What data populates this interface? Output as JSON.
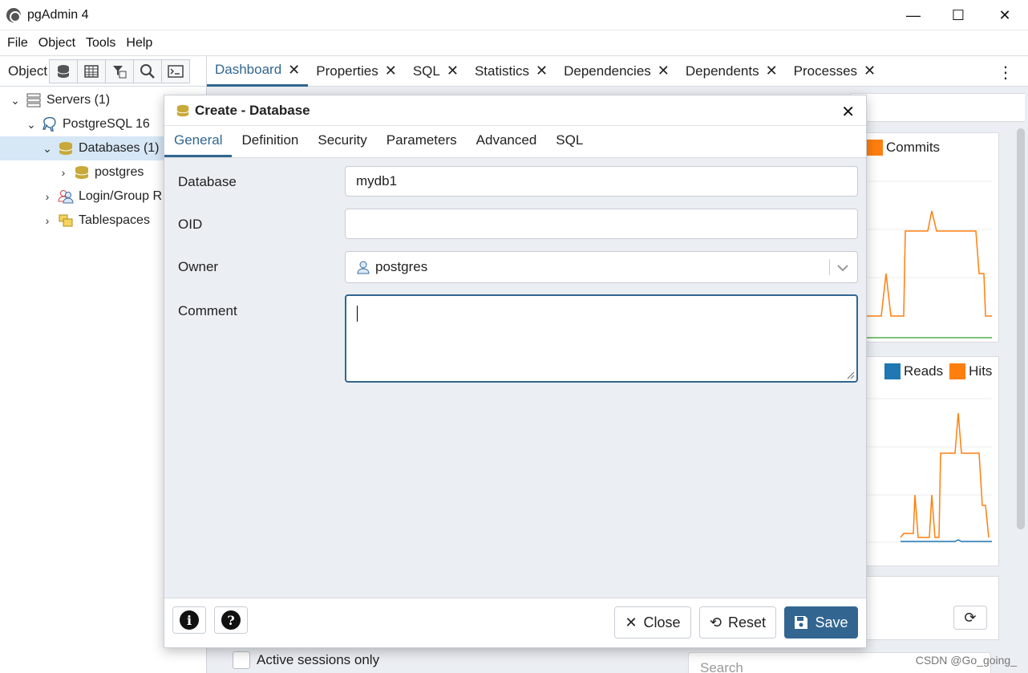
{
  "window": {
    "title": "pgAdmin 4",
    "minimize": "—",
    "maximize": "☐",
    "close": "✕"
  },
  "menu": [
    "File",
    "Object",
    "Tools",
    "Help"
  ],
  "left": {
    "title": "Object",
    "tree": [
      {
        "label": "Servers (1)",
        "chev": "⌄"
      },
      {
        "label": "PostgreSQL 16",
        "chev": "⌄"
      },
      {
        "label": "Databases (1)",
        "chev": "⌄"
      },
      {
        "label": "postgres",
        "chev": "›"
      },
      {
        "label": "Login/Group R",
        "chev": "›"
      },
      {
        "label": "Tablespaces",
        "chev": "›"
      }
    ]
  },
  "tabs": [
    "Dashboard",
    "Properties",
    "SQL",
    "Statistics",
    "Dependencies",
    "Dependents",
    "Processes"
  ],
  "dashboard": {
    "legend1": "Commits",
    "legend2a": "Reads",
    "legend2b": "Hits",
    "active_sessions": "Active sessions only",
    "search_placeholder": "Search",
    "colors": {
      "orange": "#ff7f0e",
      "blue": "#1f77b4",
      "green": "#2ca02c"
    }
  },
  "dialog": {
    "title": "Create - Database",
    "tabs": [
      "General",
      "Definition",
      "Security",
      "Parameters",
      "Advanced",
      "SQL"
    ],
    "fields": {
      "database_label": "Database",
      "database_value": "mydb1",
      "oid_label": "OID",
      "oid_value": "",
      "owner_label": "Owner",
      "owner_value": "postgres",
      "comment_label": "Comment",
      "comment_value": ""
    },
    "buttons": {
      "info": "i",
      "help": "?",
      "close": "Close",
      "reset": "Reset",
      "save": "Save"
    },
    "accent": "#326690"
  },
  "watermark": "CSDN @Go_going_"
}
